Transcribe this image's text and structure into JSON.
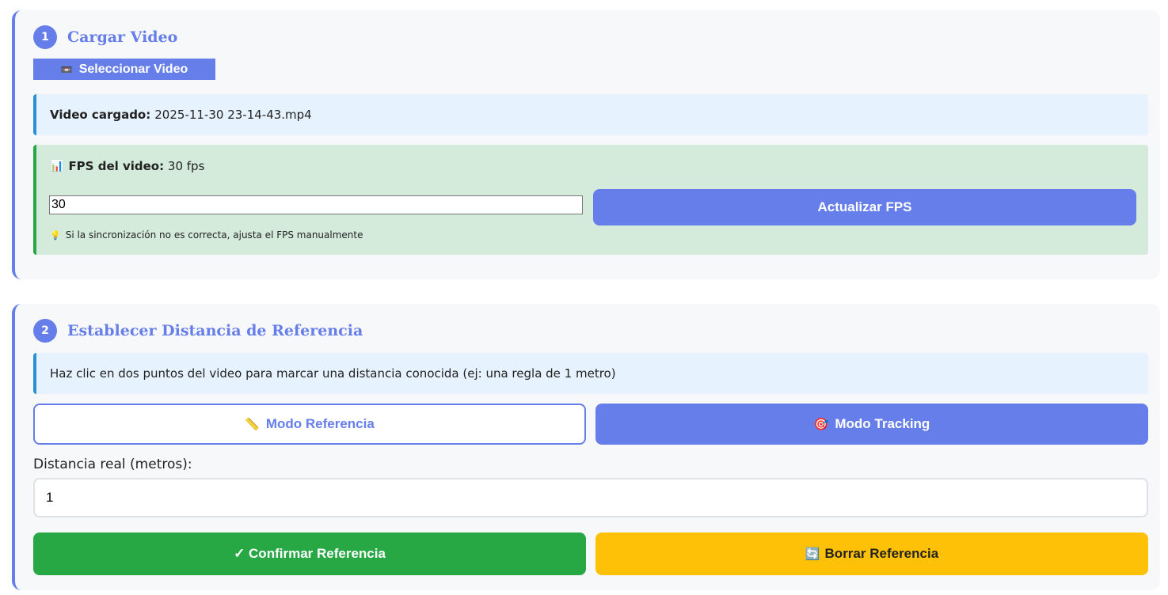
{
  "step1": {
    "number": "1",
    "title": "Cargar Video",
    "select_button": {
      "icon": "video-cassette-icon",
      "label": "Seleccionar Video"
    },
    "loaded": {
      "label": "Video cargado:",
      "value": "2025-11-30 23-14-43.mp4"
    },
    "fps": {
      "icon": "bar-chart-icon",
      "label": "FPS del video:",
      "value": "30 fps",
      "input_value": "30",
      "update_button": "Actualizar FPS",
      "hint_icon": "lightbulb-icon",
      "hint": "Si la sincronización no es correcta, ajusta el FPS manualmente"
    }
  },
  "step2": {
    "number": "2",
    "title": "Establecer Distancia de Referencia",
    "instructions": "Haz clic en dos puntos del video para marcar una distancia conocida (ej: una regla de 1 metro)",
    "modes": {
      "reference": {
        "icon": "ruler-icon",
        "label": "Modo Referencia"
      },
      "tracking": {
        "icon": "target-icon",
        "label": "Modo Tracking"
      }
    },
    "distance": {
      "label": "Distancia real (metros):",
      "value": "1"
    },
    "confirm_button": "✓ Confirmar Referencia",
    "clear_button": {
      "icon": "refresh-icon",
      "label": "Borrar Referencia"
    }
  },
  "colors": {
    "primary": "#667eea",
    "success": "#28a745",
    "warning": "#ffc107",
    "info": "#2b8fd6"
  }
}
